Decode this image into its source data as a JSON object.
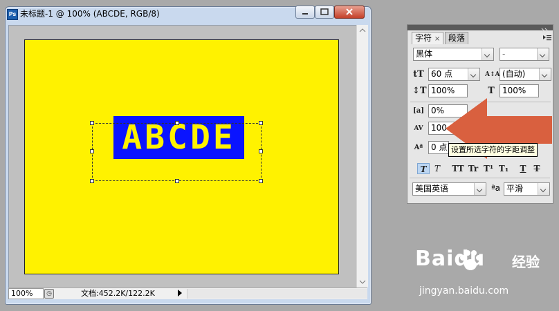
{
  "document": {
    "title": "未标题-1 @ 100% (ABCDE, RGB/8)",
    "ps_icon": "Ps",
    "canvas_text": "ABCDE",
    "canvas_color": "#fff200",
    "highlight_color": "#0a14ff",
    "status": {
      "zoom": "100%",
      "doc_info": "文档:452.2K/122.2K"
    }
  },
  "character_panel": {
    "tabs": [
      {
        "label": "字符",
        "close": "×"
      },
      {
        "label": "段落"
      }
    ],
    "font_family": "黑体",
    "font_style": "-",
    "font_size": "60 点",
    "leading": "(自动)",
    "vertical_scale": "100%",
    "horizontal_scale": "100%",
    "kerning_percent": "0%",
    "tracking": "100",
    "baseline_shift": "0 点",
    "language": "美国英语",
    "antialias": "平滑",
    "antialias_icon_text": "ªa",
    "style_buttons": [
      "T",
      "T",
      "TT",
      "Tr",
      "T¹",
      "T₁",
      "T",
      "T"
    ],
    "tooltip": "设置所选字符的字距调整"
  },
  "annotation": {
    "arrow_color": "#d9603f"
  },
  "watermark": {
    "brand": "Baidu",
    "product": "经验",
    "url": "jingyan.baidu.com"
  }
}
